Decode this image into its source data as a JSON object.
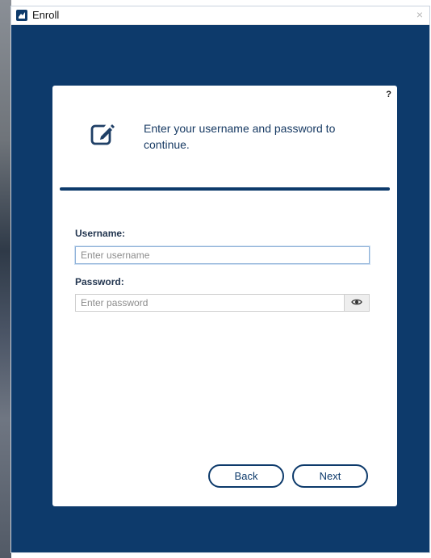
{
  "window": {
    "title": "Enroll",
    "close_glyph": "×",
    "app_icon": "enroll-app-icon"
  },
  "card": {
    "help_label": "?",
    "icon": "edit-icon",
    "instruction": "Enter your username and password to continue."
  },
  "form": {
    "username": {
      "label": "Username:",
      "value": "",
      "placeholder": "Enter username"
    },
    "password": {
      "label": "Password:",
      "value": "",
      "placeholder": "Enter password",
      "reveal_icon": "eye-icon"
    }
  },
  "buttons": {
    "back_label": "Back",
    "next_label": "Next"
  },
  "colors": {
    "brand": "#0d3a6b",
    "text_dark": "#173a63",
    "focus_border": "#8fb2d8"
  }
}
